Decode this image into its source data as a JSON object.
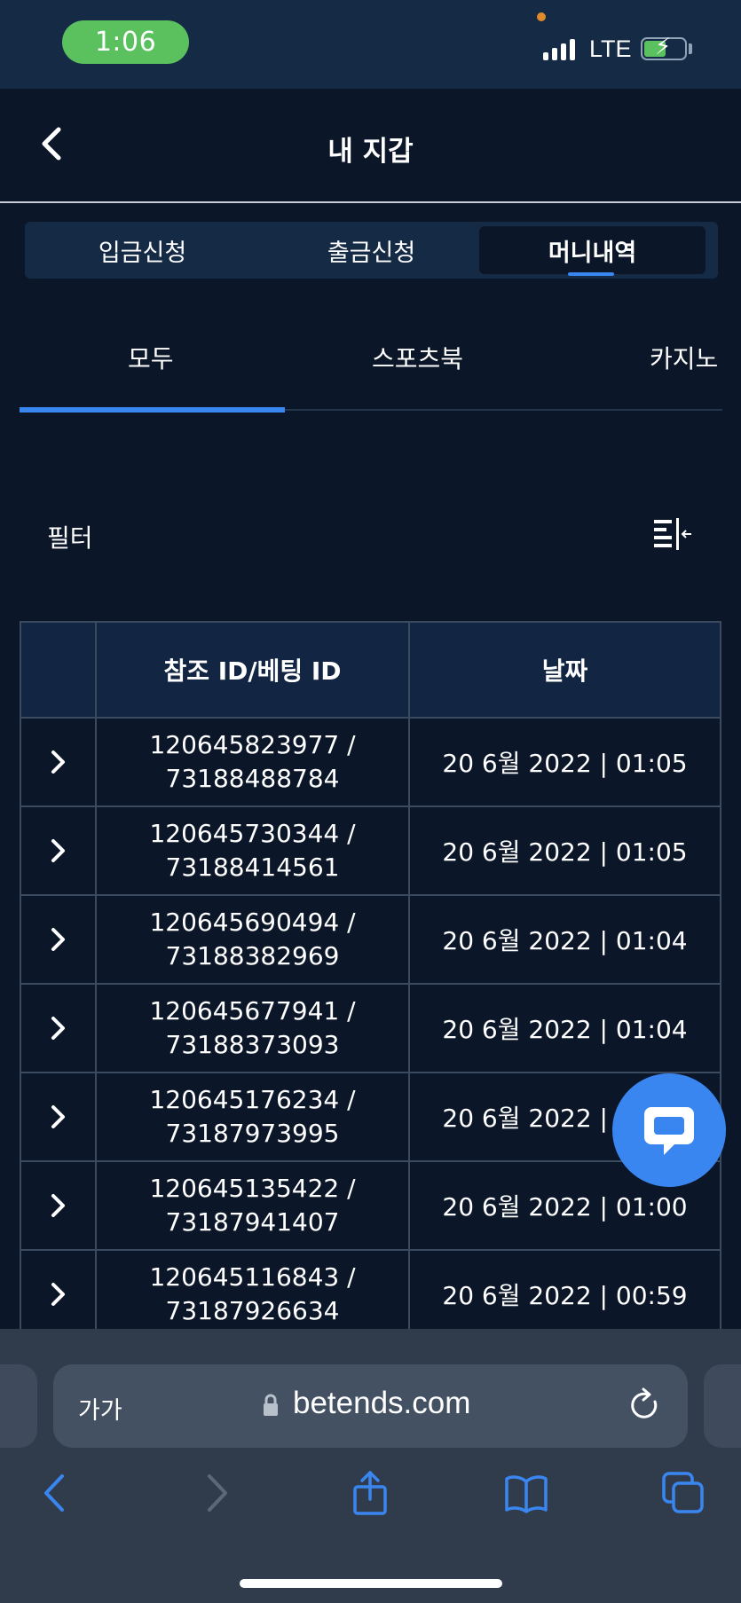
{
  "status_bar": {
    "time": "1:06",
    "network": "LTE"
  },
  "header": {
    "title": "내 지갑"
  },
  "segmented_tabs": [
    {
      "label": "입금신청",
      "active": false
    },
    {
      "label": "출금신청",
      "active": false
    },
    {
      "label": "머니내역",
      "active": true
    }
  ],
  "sub_tabs": [
    {
      "label": "모두",
      "active": true
    },
    {
      "label": "스포츠북",
      "active": false
    },
    {
      "label": "카지노",
      "active": false
    }
  ],
  "filter": {
    "label": "필터"
  },
  "table": {
    "headers": [
      "",
      "참조 ID/베팅 ID",
      "날짜"
    ],
    "rows": [
      {
        "ref_id": "120645823977 /",
        "bet_id": "73188488784",
        "date": "20 6월 2022 | 01:05"
      },
      {
        "ref_id": "120645730344 /",
        "bet_id": "73188414561",
        "date": "20 6월 2022 | 01:05"
      },
      {
        "ref_id": "120645690494 /",
        "bet_id": "73188382969",
        "date": "20 6월 2022 | 01:04"
      },
      {
        "ref_id": "120645677941 /",
        "bet_id": "73188373093",
        "date": "20 6월 2022 | 01:04"
      },
      {
        "ref_id": "120645176234 /",
        "bet_id": "73187973995",
        "date": "20 6월 2022 | 01:00"
      },
      {
        "ref_id": "120645135422 /",
        "bet_id": "73187941407",
        "date": "20 6월 2022 | 01:00"
      },
      {
        "ref_id": "120645116843 /",
        "bet_id": "73187926634",
        "date": "20 6월 2022 | 00:59"
      }
    ]
  },
  "browser": {
    "text_size_label": "가가",
    "url": "betends.com"
  },
  "colors": {
    "accent": "#3a86f0",
    "background": "#0b1628",
    "panel": "#152a45",
    "status_green": "#5bc15e"
  }
}
